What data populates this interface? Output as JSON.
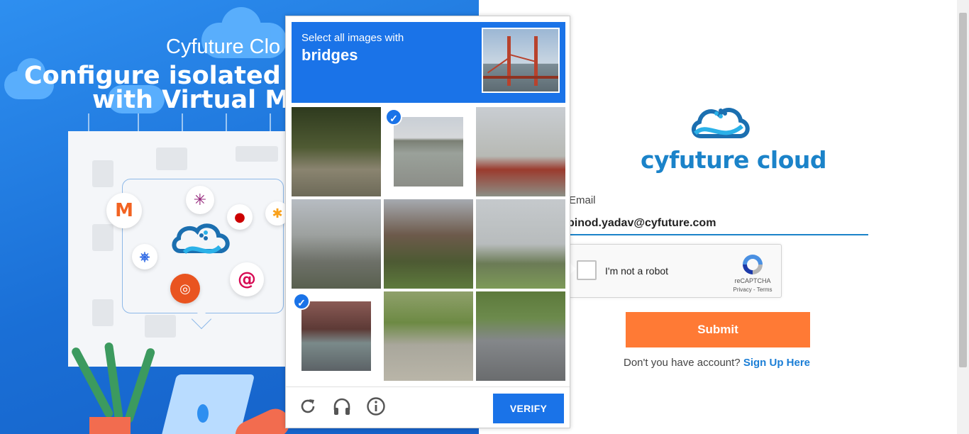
{
  "hero": {
    "subtitle": "Cyfuture Clo",
    "title_line1": "Configure isolated c",
    "title_line2": "with Virtual Ma"
  },
  "brand": {
    "name": "cyfuture cloud"
  },
  "login": {
    "email_label": "Email",
    "email_value": "pinod.yadav@cyfuture.com",
    "recaptcha": {
      "checkbox_label": "I'm not a robot",
      "brand": "reCAPTCHA",
      "links": "Privacy - Terms"
    },
    "submit_label": "Submit",
    "signup_prompt": "Don't you have account?",
    "signup_link": "Sign Up Here"
  },
  "challenge": {
    "prompt": "Select all images with",
    "target": "bridges",
    "tiles": [
      {
        "label": "tile-1",
        "selected": false
      },
      {
        "label": "tile-2",
        "selected": true
      },
      {
        "label": "tile-3",
        "selected": false
      },
      {
        "label": "tile-4",
        "selected": false
      },
      {
        "label": "tile-5",
        "selected": false
      },
      {
        "label": "tile-6",
        "selected": false
      },
      {
        "label": "tile-7",
        "selected": true
      },
      {
        "label": "tile-8",
        "selected": false
      },
      {
        "label": "tile-9",
        "selected": false
      }
    ],
    "verify_label": "VERIFY",
    "icons": [
      "reload-icon",
      "audio-icon",
      "info-icon"
    ]
  },
  "colors": {
    "accent": "#1a73e8",
    "submit": "#ff7a35",
    "brand": "#1b83c9"
  }
}
